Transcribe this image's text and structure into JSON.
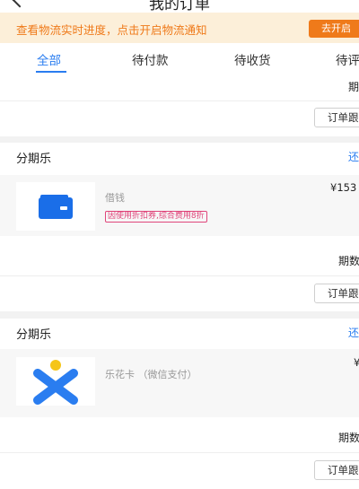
{
  "header": {
    "title": "我的订单"
  },
  "notice": {
    "text": "查看物流实时进度，点击开启物流通知",
    "button": "去开启"
  },
  "tabs": [
    {
      "label": "全部",
      "active": true
    },
    {
      "label": "待付款",
      "active": false
    },
    {
      "label": "待收货",
      "active": false
    },
    {
      "label": "待评",
      "active": false
    }
  ],
  "orders": [
    {
      "period_label": "期",
      "detail_button": "订单跟"
    },
    {
      "section": "分期乐",
      "link": "还",
      "product": {
        "name": "借钱",
        "tag": "因使用折扣券,综合费用8折",
        "price": "¥153"
      },
      "period_label": "期数",
      "detail_button": "订单跟"
    },
    {
      "section": "分期乐",
      "link": "还",
      "product": {
        "name": "乐花卡 （微信支付）",
        "price": "¥"
      },
      "period_label": "期数",
      "detail_button": "订单跟"
    }
  ],
  "colors": {
    "accent": "#2a7df0",
    "notice_bg": "#fcefd9",
    "notice_fg": "#ef7a1a",
    "tag": "#e0457a"
  }
}
